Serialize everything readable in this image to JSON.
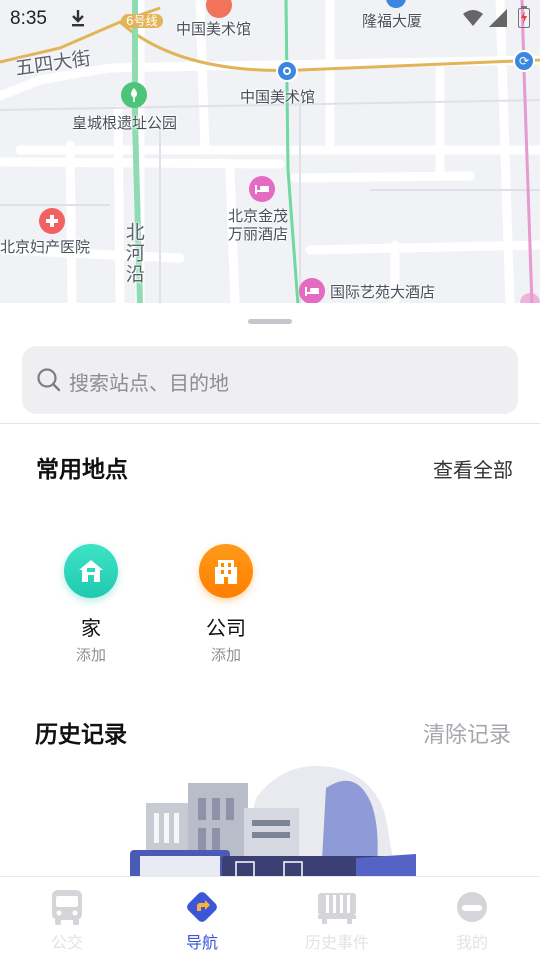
{
  "status_bar": {
    "time": "8:35"
  },
  "map": {
    "labels": {
      "line6_badge": "6号线",
      "gallery_top": "中国美术馆",
      "longfu": "隆福大厦",
      "wusi_street": "五四大街",
      "gallery_station": "中国美术馆",
      "imperial_park": "皇城根遗址公园",
      "hotel_jinmao_line1": "北京金茂",
      "hotel_jinmao_line2": "万丽酒店",
      "maternity_hospital": "北京妇产医院",
      "beiheyan": "北河沿",
      "intl_hotel": "国际艺苑大酒店"
    }
  },
  "search": {
    "placeholder": "搜索站点、目的地"
  },
  "favorites": {
    "title": "常用地点",
    "view_all": "查看全部",
    "items": [
      {
        "name": "家",
        "sub": "添加",
        "icon": "home-icon",
        "color": "#2fd6bf"
      },
      {
        "name": "公司",
        "sub": "添加",
        "icon": "building-icon",
        "color": "#ff8a00"
      }
    ]
  },
  "history": {
    "title": "历史记录",
    "clear": "清除记录"
  },
  "tabs": [
    {
      "label": "公交",
      "icon": "bus-icon",
      "active": false
    },
    {
      "label": "导航",
      "icon": "navigation-icon",
      "active": true
    },
    {
      "label": "历史事件",
      "icon": "history-events-icon",
      "active": false
    },
    {
      "label": "我的",
      "icon": "profile-icon",
      "active": false
    }
  ],
  "colors": {
    "accent": "#3b56d6",
    "inactive_tab": "#cfd0d4",
    "search_bg": "#efeff2",
    "clear_text": "#a5a7ad",
    "map_bg": "#f1f2f5",
    "road_highlight": "#e2b457",
    "metro_green": "#6ed9a0",
    "metro_pink": "#e79ad1"
  }
}
